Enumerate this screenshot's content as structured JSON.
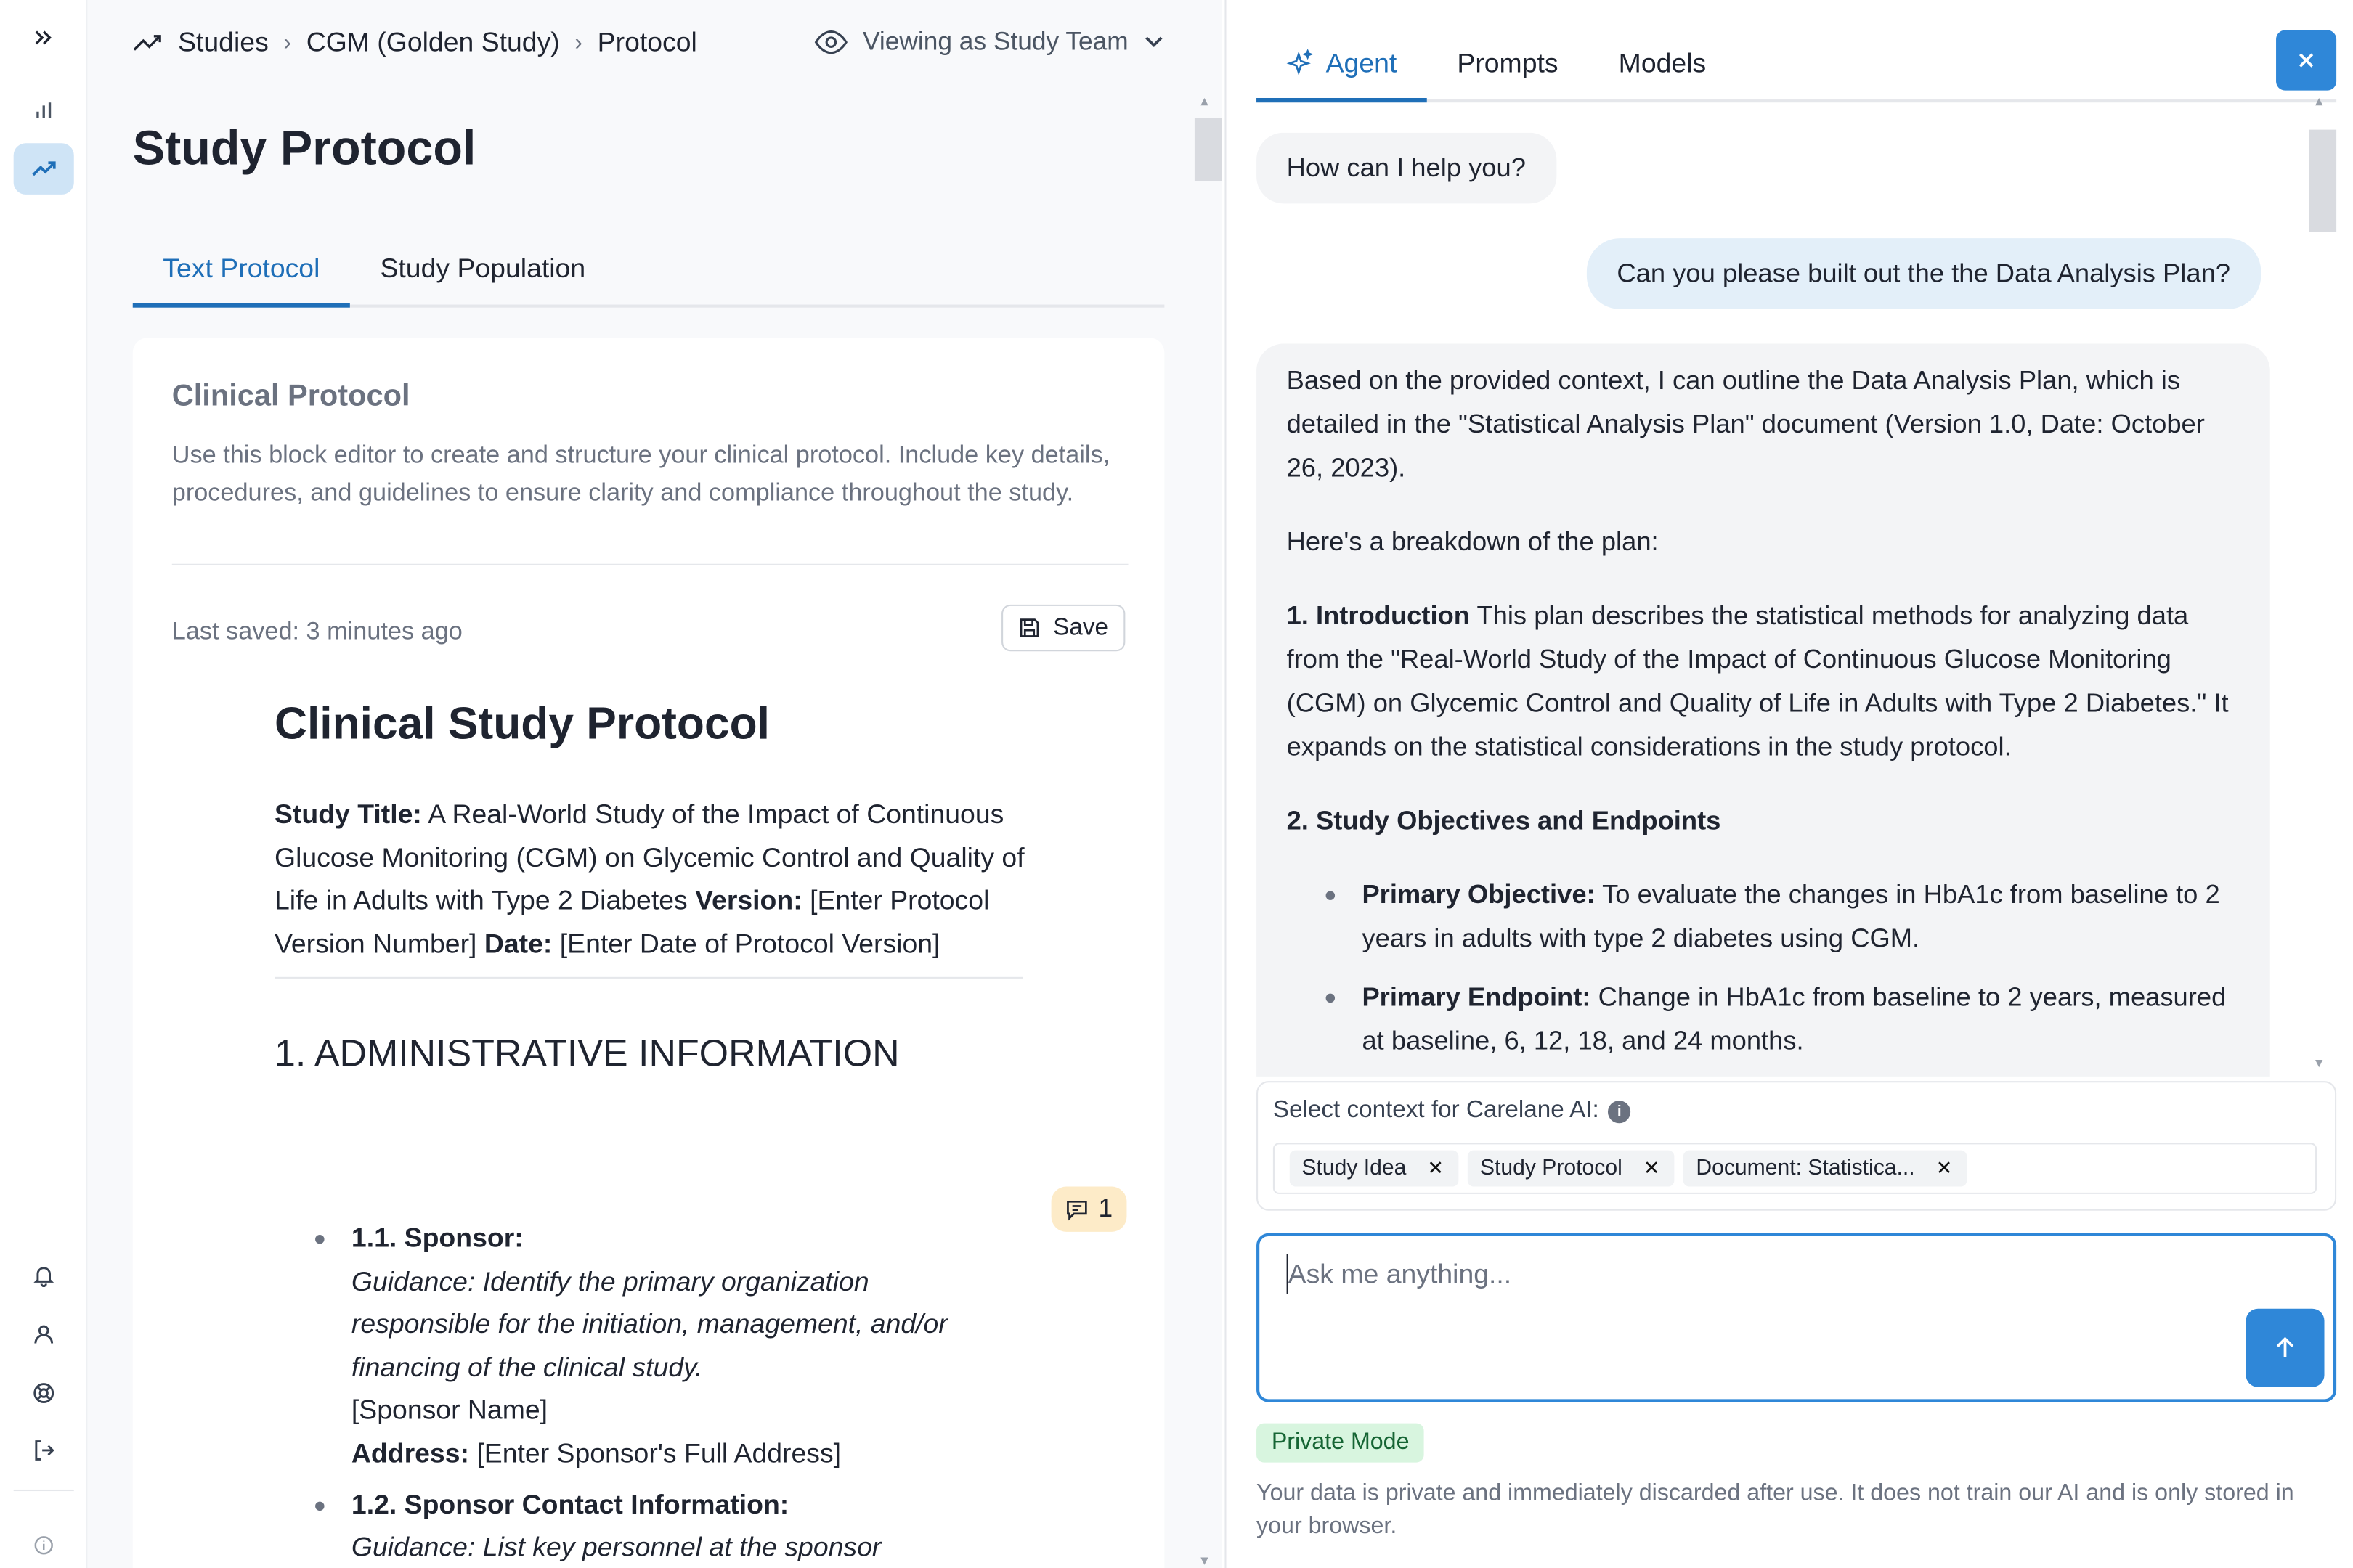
{
  "breadcrumb": {
    "items": [
      "Studies",
      "CGM (Golden Study)",
      "Protocol"
    ]
  },
  "viewing": {
    "label": "Viewing as Study Team"
  },
  "page": {
    "title": "Study Protocol"
  },
  "left_tabs": [
    {
      "label": "Text Protocol",
      "active": true
    },
    {
      "label": "Study Population",
      "active": false
    }
  ],
  "card": {
    "heading": "Clinical Protocol",
    "description": "Use this block editor to create and structure your clinical protocol. Include key details, procedures, and guidelines to ensure clarity and compliance throughout the study.",
    "last_saved": "Last saved: 3 minutes ago",
    "save_label": "Save"
  },
  "document": {
    "title": "Clinical Study Protocol",
    "study_title_label": "Study Title:",
    "study_title": "A Real-World Study of the Impact of Continuous Glucose Monitoring (CGM) on Glycemic Control and Quality of Life in Adults with Type 2 Diabetes",
    "version_label": "Version:",
    "version_value": "[Enter Protocol Version Number]",
    "date_label": "Date:",
    "date_value": "[Enter Date of Protocol Version]",
    "section1": "1. ADMINISTRATIVE INFORMATION",
    "comment_count": "1",
    "items": [
      {
        "heading": "1.1. Sponsor:",
        "guidance": "Guidance: Identify the primary organization responsible for the initiation, management, and/or financing of the clinical study.",
        "placeholder": "[Sponsor Name]",
        "address_label": "Address:",
        "address_value": "[Enter Sponsor's Full Address]"
      },
      {
        "heading": "1.2. Sponsor Contact Information:",
        "guidance": "Guidance: List key personnel at the sponsor"
      }
    ]
  },
  "right_tabs": [
    {
      "label": "Agent",
      "active": true
    },
    {
      "label": "Prompts",
      "active": false
    },
    {
      "label": "Models",
      "active": false
    }
  ],
  "chat": {
    "greeting": "How can I help you?",
    "user_message": "Can you please built out the the Data Analysis Plan?",
    "answer_intro": "Based on the provided context, I can outline the Data Analysis Plan, which is detailed in the \"Statistical Analysis Plan\" document (Version 1.0, Date: October 26, 2023).",
    "answer_breakdown": "Here's a breakdown of the plan:",
    "intro_label": "1. Introduction",
    "intro_text": "This plan describes the statistical methods for analyzing data from the \"Real-World Study of the Impact of Continuous Glucose Monitoring (CGM) on Glycemic Control and Quality of Life in Adults with Type 2 Diabetes.\" It expands on the statistical considerations in the study protocol.",
    "objectives_heading": "2. Study Objectives and Endpoints",
    "bullets": [
      {
        "label": "Primary Objective:",
        "text": "To evaluate the changes in HbA1c from baseline to 2 years in adults with type 2 diabetes using CGM."
      },
      {
        "label": "Primary Endpoint:",
        "text": "Change in HbA1c from baseline to 2 years, measured at baseline, 6, 12, 18, and 24 months."
      }
    ]
  },
  "context": {
    "label": "Select context for Carelane AI:",
    "chips": [
      "Study Idea",
      "Study Protocol",
      "Document: Statistica..."
    ]
  },
  "input": {
    "placeholder": "Ask me anything..."
  },
  "private_mode": "Private Mode",
  "disclaimer": "Your data is private and immediately discarded after use. It does not train our AI and is only stored in your browser.",
  "colors": {
    "accent": "#2f87d8",
    "tab_active": "#1f6fb8",
    "private_bg": "#d8f5df",
    "comment_bg": "#fdebc8"
  }
}
